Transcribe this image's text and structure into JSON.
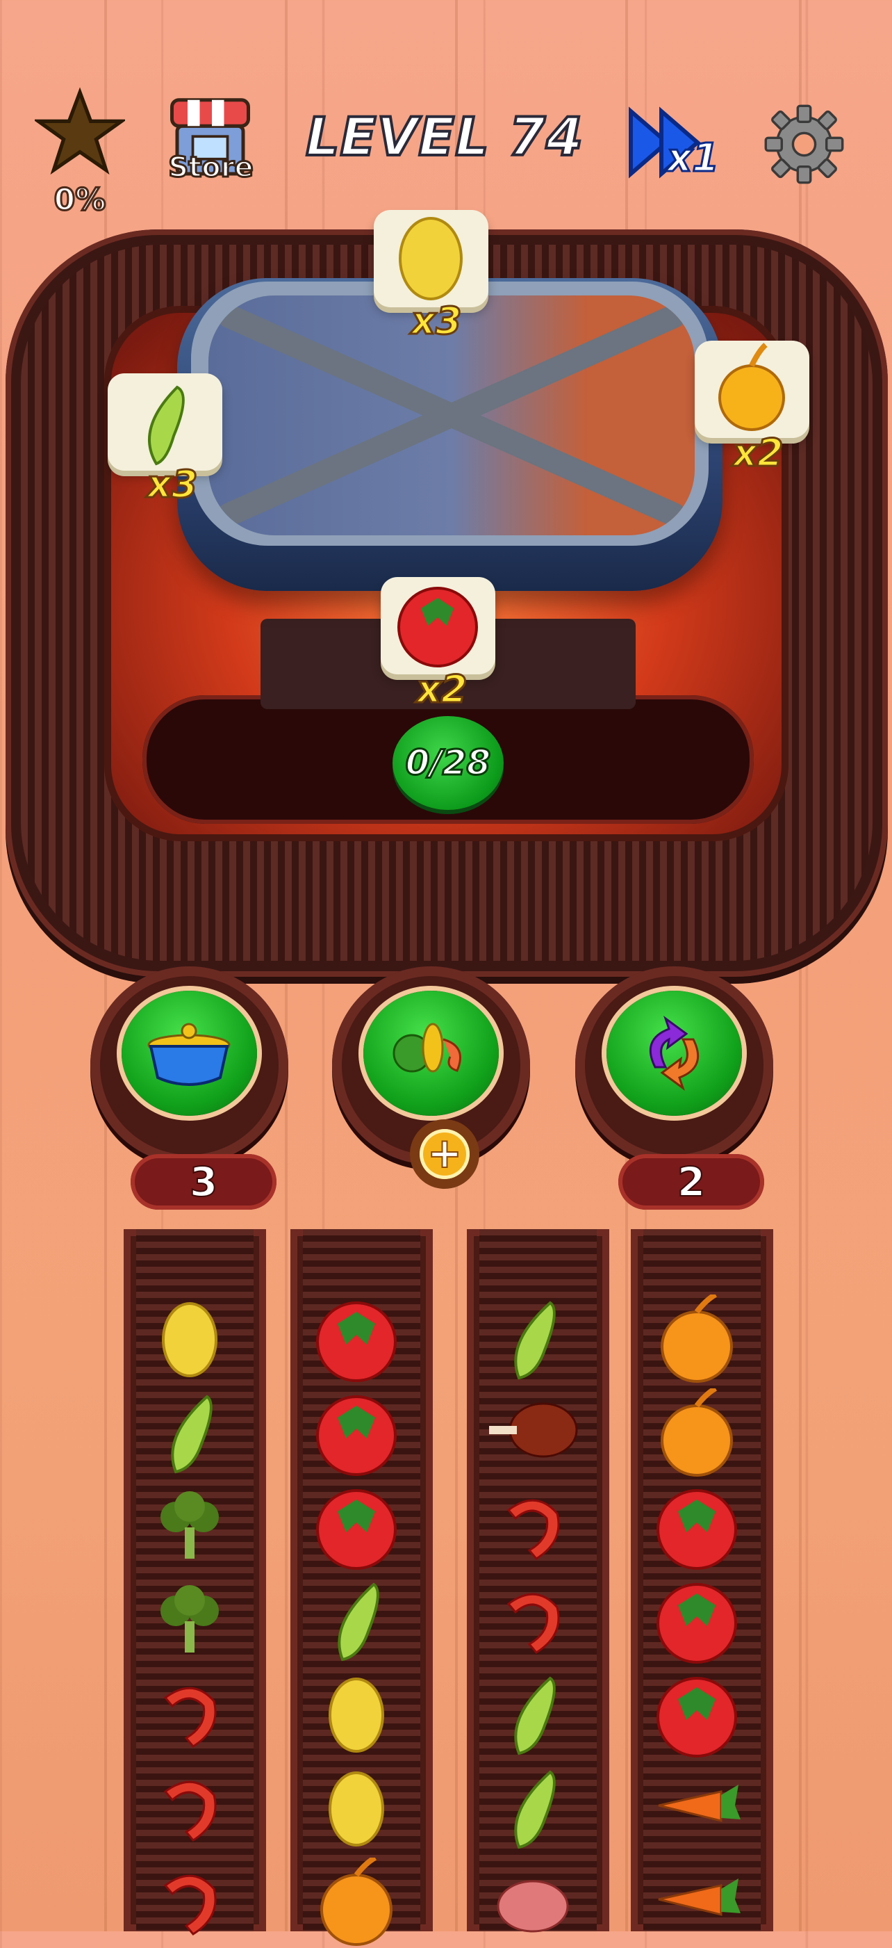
{
  "hud": {
    "star_percent": "0%",
    "store_label": "Store",
    "level_title": "LEVEL 74",
    "speed_label": "x1"
  },
  "order": {
    "progress": "0/28",
    "cards": [
      {
        "item": "potato-icon",
        "count": "x3"
      },
      {
        "item": "green-pepper-icon",
        "count": "x3"
      },
      {
        "item": "onion-icon",
        "count": "x2"
      },
      {
        "item": "tomato-icon",
        "count": "x2"
      }
    ]
  },
  "boosters": [
    {
      "icon": "pot-icon",
      "count": "3"
    },
    {
      "icon": "vegetables-icon",
      "count": ""
    },
    {
      "icon": "shuffle-icon",
      "count": "2"
    }
  ],
  "lanes": [
    [
      "potato",
      "green-pepper",
      "broccoli",
      "broccoli",
      "shrimp",
      "shrimp",
      "shrimp"
    ],
    [
      "tomato",
      "tomato",
      "tomato",
      "green-pepper",
      "potato",
      "potato",
      "onion"
    ],
    [
      "green-pepper",
      "drumstick",
      "shrimp",
      "shrimp",
      "green-pepper",
      "green-pepper",
      "meat"
    ],
    [
      "onion",
      "onion",
      "tomato",
      "tomato",
      "tomato",
      "carrot",
      "carrot"
    ]
  ],
  "colors": {
    "accent_green": "#10a01a",
    "wood": "#f4a07c",
    "belt": "#3b1713",
    "count_yellow": "#ffe53a"
  }
}
